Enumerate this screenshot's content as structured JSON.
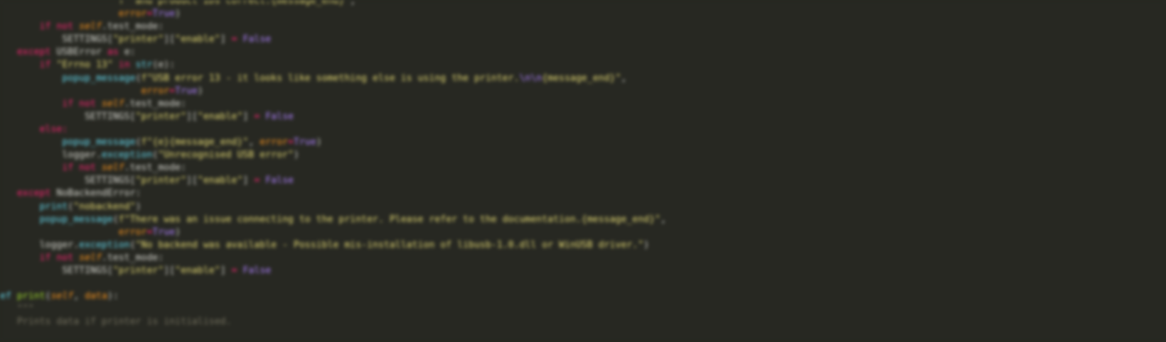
{
  "editor": {
    "theme_colors": {
      "background": "#272822",
      "keyword": "#f92672",
      "string": "#e6db74",
      "boolean": "#ae81ff",
      "function": "#a6e22e",
      "builtin": "#66d9ef",
      "self": "#fd971f",
      "comment": "#75715e"
    },
    "lines": [
      {
        "indent": "                     ",
        "tokens": [
          {
            "t": "str",
            "v": "f\" and product IDs correct.{message_end}\""
          },
          {
            "t": "plain",
            "v": ","
          }
        ]
      },
      {
        "indent": "                     ",
        "tokens": [
          {
            "t": "param",
            "v": "error"
          },
          {
            "t": "op",
            "v": "="
          },
          {
            "t": "bool",
            "v": "True"
          },
          {
            "t": "plain",
            "v": ")"
          }
        ]
      },
      {
        "indent": "       ",
        "tokens": [
          {
            "t": "kw",
            "v": "if not "
          },
          {
            "t": "self",
            "v": "self"
          },
          {
            "t": "plain",
            "v": ".test_mode:"
          }
        ]
      },
      {
        "indent": "           ",
        "tokens": [
          {
            "t": "plain",
            "v": "SETTINGS["
          },
          {
            "t": "str",
            "v": "\"printer\""
          },
          {
            "t": "plain",
            "v": "]["
          },
          {
            "t": "str",
            "v": "\"enable\""
          },
          {
            "t": "plain",
            "v": "] "
          },
          {
            "t": "op",
            "v": "="
          },
          {
            "t": "plain",
            "v": " "
          },
          {
            "t": "bool",
            "v": "False"
          }
        ]
      },
      {
        "indent": "   ",
        "tokens": [
          {
            "t": "kw",
            "v": "except "
          },
          {
            "t": "plain",
            "v": "USBError "
          },
          {
            "t": "kw",
            "v": "as "
          },
          {
            "t": "plain",
            "v": "e:"
          }
        ]
      },
      {
        "indent": "       ",
        "tokens": [
          {
            "t": "kw",
            "v": "if "
          },
          {
            "t": "str",
            "v": "\"Errno 13\""
          },
          {
            "t": "kw",
            "v": " in "
          },
          {
            "t": "builtin",
            "v": "str"
          },
          {
            "t": "plain",
            "v": "(e):"
          }
        ]
      },
      {
        "indent": "           ",
        "tokens": [
          {
            "t": "fnc",
            "v": "popup_message"
          },
          {
            "t": "plain",
            "v": "("
          },
          {
            "t": "str",
            "v": "f\"USB error 13 - it looks like something else is using the printer."
          },
          {
            "t": "esc",
            "v": "\\n\\n"
          },
          {
            "t": "str",
            "v": "{message_end}\""
          },
          {
            "t": "plain",
            "v": ","
          }
        ]
      },
      {
        "indent": "                         ",
        "tokens": [
          {
            "t": "param",
            "v": "error"
          },
          {
            "t": "op",
            "v": "="
          },
          {
            "t": "bool",
            "v": "True"
          },
          {
            "t": "plain",
            "v": ")"
          }
        ]
      },
      {
        "indent": "           ",
        "tokens": [
          {
            "t": "kw",
            "v": "if not "
          },
          {
            "t": "self",
            "v": "self"
          },
          {
            "t": "plain",
            "v": ".test_mode:"
          }
        ]
      },
      {
        "indent": "               ",
        "tokens": [
          {
            "t": "plain",
            "v": "SETTINGS["
          },
          {
            "t": "str",
            "v": "\"printer\""
          },
          {
            "t": "plain",
            "v": "]["
          },
          {
            "t": "str",
            "v": "\"enable\""
          },
          {
            "t": "plain",
            "v": "] "
          },
          {
            "t": "op",
            "v": "="
          },
          {
            "t": "plain",
            "v": " "
          },
          {
            "t": "bool",
            "v": "False"
          }
        ]
      },
      {
        "indent": "       ",
        "tokens": [
          {
            "t": "kw",
            "v": "else:"
          }
        ]
      },
      {
        "indent": "           ",
        "tokens": [
          {
            "t": "fnc",
            "v": "popup_message"
          },
          {
            "t": "plain",
            "v": "("
          },
          {
            "t": "str",
            "v": "f\"{e}{message_end}\""
          },
          {
            "t": "plain",
            "v": ", "
          },
          {
            "t": "param",
            "v": "error"
          },
          {
            "t": "op",
            "v": "="
          },
          {
            "t": "bool",
            "v": "True"
          },
          {
            "t": "plain",
            "v": ")"
          }
        ]
      },
      {
        "indent": "           ",
        "tokens": [
          {
            "t": "plain",
            "v": "logger."
          },
          {
            "t": "fnc",
            "v": "exception"
          },
          {
            "t": "plain",
            "v": "("
          },
          {
            "t": "str",
            "v": "\"Unrecognised USB error\""
          },
          {
            "t": "plain",
            "v": ")"
          }
        ]
      },
      {
        "indent": "           ",
        "tokens": [
          {
            "t": "kw",
            "v": "if not "
          },
          {
            "t": "self",
            "v": "self"
          },
          {
            "t": "plain",
            "v": ".test_mode:"
          }
        ]
      },
      {
        "indent": "               ",
        "tokens": [
          {
            "t": "plain",
            "v": "SETTINGS["
          },
          {
            "t": "str",
            "v": "\"printer\""
          },
          {
            "t": "plain",
            "v": "]["
          },
          {
            "t": "str",
            "v": "\"enable\""
          },
          {
            "t": "plain",
            "v": "] "
          },
          {
            "t": "op",
            "v": "="
          },
          {
            "t": "plain",
            "v": " "
          },
          {
            "t": "bool",
            "v": "False"
          }
        ]
      },
      {
        "indent": "   ",
        "tokens": [
          {
            "t": "kw",
            "v": "except "
          },
          {
            "t": "plain",
            "v": "NoBackendError:"
          }
        ]
      },
      {
        "indent": "       ",
        "tokens": [
          {
            "t": "builtin",
            "v": "print"
          },
          {
            "t": "plain",
            "v": "("
          },
          {
            "t": "str",
            "v": "\"nobackend\""
          },
          {
            "t": "plain",
            "v": ")"
          }
        ]
      },
      {
        "indent": "       ",
        "tokens": [
          {
            "t": "fnc",
            "v": "popup_message"
          },
          {
            "t": "plain",
            "v": "("
          },
          {
            "t": "str",
            "v": "f\"There was an issue connecting to the printer. Please refer to the documentation.{message_end}\""
          },
          {
            "t": "plain",
            "v": ","
          }
        ]
      },
      {
        "indent": "                     ",
        "tokens": [
          {
            "t": "param",
            "v": "error"
          },
          {
            "t": "op",
            "v": "="
          },
          {
            "t": "bool",
            "v": "True"
          },
          {
            "t": "plain",
            "v": ")"
          }
        ]
      },
      {
        "indent": "       ",
        "tokens": [
          {
            "t": "plain",
            "v": "logger."
          },
          {
            "t": "fnc",
            "v": "exception"
          },
          {
            "t": "plain",
            "v": "("
          },
          {
            "t": "str",
            "v": "\"No backend was available - Possible mis-installation of libusb-1.0.dll or WinUSB driver.\""
          },
          {
            "t": "plain",
            "v": ")"
          }
        ]
      },
      {
        "indent": "       ",
        "tokens": [
          {
            "t": "kw",
            "v": "if not "
          },
          {
            "t": "self",
            "v": "self"
          },
          {
            "t": "plain",
            "v": ".test_mode:"
          }
        ]
      },
      {
        "indent": "           ",
        "tokens": [
          {
            "t": "plain",
            "v": "SETTINGS["
          },
          {
            "t": "str",
            "v": "\"printer\""
          },
          {
            "t": "plain",
            "v": "]["
          },
          {
            "t": "str",
            "v": "\"enable\""
          },
          {
            "t": "plain",
            "v": "] "
          },
          {
            "t": "op",
            "v": "="
          },
          {
            "t": "plain",
            "v": " "
          },
          {
            "t": "bool",
            "v": "False"
          }
        ]
      },
      {
        "indent": "",
        "tokens": []
      },
      {
        "indent": "",
        "tokens": [
          {
            "t": "builtin",
            "v": "ef "
          },
          {
            "t": "fn",
            "v": "print"
          },
          {
            "t": "plain",
            "v": "("
          },
          {
            "t": "self",
            "v": "self"
          },
          {
            "t": "plain",
            "v": ", "
          },
          {
            "t": "param",
            "v": "data"
          },
          {
            "t": "plain",
            "v": "):"
          }
        ]
      },
      {
        "indent": "   ",
        "tokens": [
          {
            "t": "comment",
            "v": "\"\"\""
          }
        ]
      },
      {
        "indent": "   ",
        "tokens": [
          {
            "t": "comment",
            "v": "Prints data if printer is initialised."
          }
        ]
      }
    ]
  }
}
